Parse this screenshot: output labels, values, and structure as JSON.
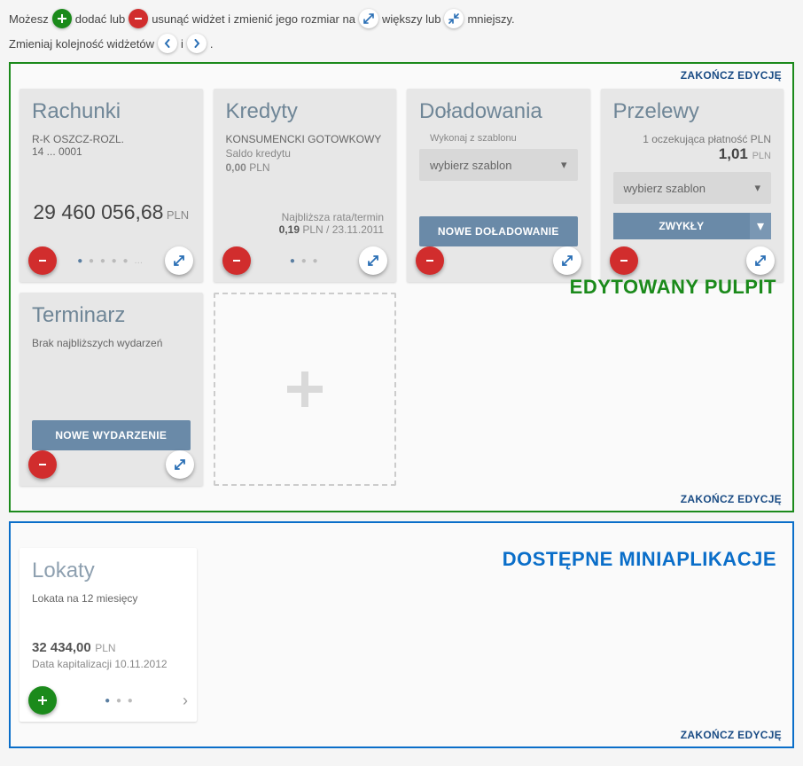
{
  "intro": {
    "t1": "Możesz",
    "t2": "dodać lub",
    "t3": "usunąć widżet i zmienić jego rozmiar na",
    "t4": "większy lub",
    "t5": "mniejszy.",
    "row2a": "Zmieniaj kolejność widżetów",
    "row2b": "i",
    "row2c": "."
  },
  "finish_link": "ZAKOŃCZ EDYCJĘ",
  "edited_label": "EDYTOWANY PULPIT",
  "available_label": "DOSTĘPNE MINIAPLIKACJE",
  "widgets": {
    "rachunki": {
      "title": "Rachunki",
      "acct_name": "R-K OSZCZ-ROZL.",
      "acct_num": "14 ... 0001",
      "balance": "29 460 056,68",
      "currency": "PLN"
    },
    "kredyty": {
      "title": "Kredyty",
      "name": "KONSUMENCKI GOTOWKOWY",
      "saldo_label": "Saldo kredytu",
      "saldo_val": "0,00",
      "currency": "PLN",
      "next_label": "Najbliższa rata/termin",
      "next_val": "0,19",
      "next_date": "23.11.2011"
    },
    "doladowania": {
      "title": "Doładowania",
      "template_label": "Wykonaj z szablonu",
      "template_placeholder": "wybierz szablon",
      "button": "NOWE DOŁADOWANIE"
    },
    "przelewy": {
      "title": "Przelewy",
      "pending_label": "1 oczekująca płatność PLN",
      "pending_val": "1,01",
      "currency": "PLN",
      "template_placeholder": "wybierz szablon",
      "button": "ZWYKŁY"
    },
    "terminarz": {
      "title": "Terminarz",
      "empty": "Brak najbliższych wydarzeń",
      "button": "NOWE WYDARZENIE"
    },
    "lokaty": {
      "title": "Lokaty",
      "name": "Lokata na 12 miesięcy",
      "amount": "32 434,00",
      "currency": "PLN",
      "cap_label": "Data kapitalizacji 10.11.2012"
    }
  }
}
